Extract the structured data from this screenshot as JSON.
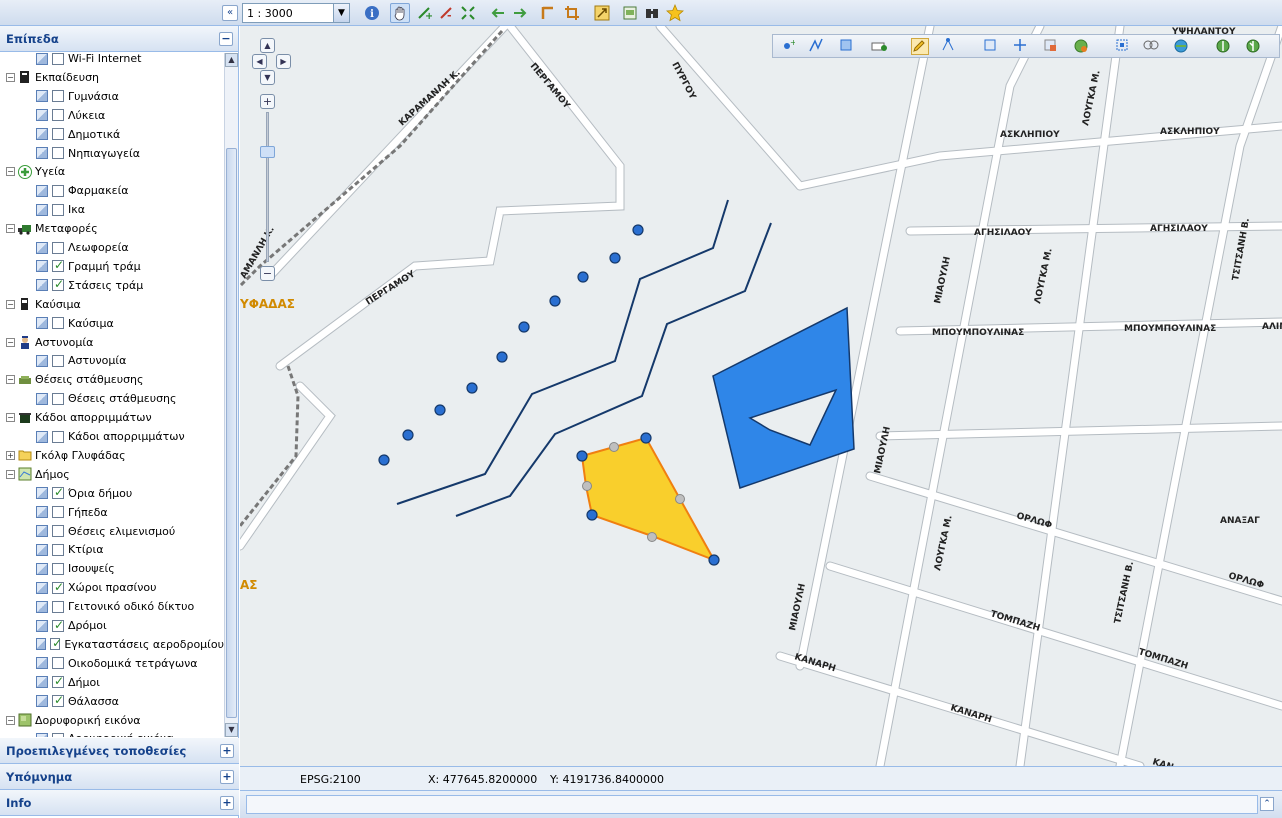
{
  "toolbar": {
    "scale_value": "1 : 3000",
    "collapse_icon": "double-chevron-left-icon",
    "tools": [
      "info-icon",
      "pan-hand-icon",
      "zoom-in-icon",
      "zoom-out-icon",
      "zoom-extent-icon",
      "previous-extent-icon",
      "next-extent-icon",
      "measure-distance-icon",
      "measure-area-icon",
      "export-icon",
      "print-icon",
      "bookmark-icon",
      "favorite-star-icon"
    ]
  },
  "left_panel": {
    "layers_title": "Επίπεδα",
    "sections": [
      {
        "title": "Προεπιλεγμένες τοποθεσίες"
      },
      {
        "title": "Υπόμνημα"
      },
      {
        "title": "Info"
      }
    ],
    "tree": [
      {
        "kind": "layer",
        "label": "Wi-Fi Internet",
        "checked": false
      },
      {
        "kind": "group",
        "label": "Εκπαίδευση",
        "icon": "education-icon"
      },
      {
        "kind": "layer",
        "label": "Γυμνάσια",
        "checked": false
      },
      {
        "kind": "layer",
        "label": "Λύκεια",
        "checked": false
      },
      {
        "kind": "layer",
        "label": "Δημοτικά",
        "checked": false
      },
      {
        "kind": "layer",
        "label": "Νηπιαγωγεία",
        "checked": false
      },
      {
        "kind": "group",
        "label": "Υγεία",
        "icon": "health-cross-icon"
      },
      {
        "kind": "layer",
        "label": "Φαρμακεία",
        "checked": false
      },
      {
        "kind": "layer",
        "label": "Ικα",
        "checked": false
      },
      {
        "kind": "group",
        "label": "Μεταφορές",
        "icon": "transport-truck-icon"
      },
      {
        "kind": "layer",
        "label": "Λεωφορεία",
        "checked": false
      },
      {
        "kind": "layer",
        "label": "Γραμμή τράμ",
        "checked": true
      },
      {
        "kind": "layer",
        "label": "Στάσεις τράμ",
        "checked": true
      },
      {
        "kind": "group",
        "label": "Καύσιμα",
        "icon": "fuel-pump-icon"
      },
      {
        "kind": "layer",
        "label": "Καύσιμα",
        "checked": false
      },
      {
        "kind": "group",
        "label": "Αστυνομία",
        "icon": "police-officer-icon"
      },
      {
        "kind": "layer",
        "label": "Αστυνομία",
        "checked": false
      },
      {
        "kind": "group",
        "label": "Θέσεις στάθμευσης",
        "icon": "parking-car-icon"
      },
      {
        "kind": "layer",
        "label": "Θέσεις στάθμευσης",
        "checked": false
      },
      {
        "kind": "group",
        "label": "Κάδοι απορριμμάτων",
        "icon": "trash-bin-icon"
      },
      {
        "kind": "layer",
        "label": "Κάδοι απορριμμάτων",
        "checked": false
      },
      {
        "kind": "group",
        "label": "Γκόλφ Γλυφάδας",
        "icon": "folder-icon",
        "collapsed": true
      },
      {
        "kind": "group",
        "label": "Δήμος",
        "icon": "municipality-map-icon"
      },
      {
        "kind": "layer",
        "label": "Όρια δήμου",
        "checked": true
      },
      {
        "kind": "layer",
        "label": "Γήπεδα",
        "checked": false
      },
      {
        "kind": "layer",
        "label": "Θέσεις ελιμενισμού",
        "checked": false
      },
      {
        "kind": "layer",
        "label": "Κτίρια",
        "checked": false
      },
      {
        "kind": "layer",
        "label": "Ισουψείς",
        "checked": false
      },
      {
        "kind": "layer",
        "label": "Χώροι πρασίνου",
        "checked": true
      },
      {
        "kind": "layer",
        "label": "Γειτονικό οδικό δίκτυο",
        "checked": false
      },
      {
        "kind": "layer",
        "label": "Δρόμοι",
        "checked": true
      },
      {
        "kind": "layer",
        "label": "Εγκαταστάσεις αεροδρομίου",
        "checked": true
      },
      {
        "kind": "layer",
        "label": "Οικοδομικά τετράγωνα",
        "checked": false
      },
      {
        "kind": "layer",
        "label": "Δήμοι",
        "checked": true
      },
      {
        "kind": "layer",
        "label": "Θάλασσα",
        "checked": true
      },
      {
        "kind": "group",
        "label": "Δορυφορική εικόνα",
        "icon": "satellite-image-icon"
      },
      {
        "kind": "layer",
        "label": "Δορυφορική εικόνα",
        "checked": false
      }
    ]
  },
  "map": {
    "streets": {
      "ypsilantou": "ΥΨΗΛΑΝΤΟΥ",
      "pyrgou": "ΠΥΡΓΟΥ",
      "pergamou": "ΠΕΡΓΑΜΟΥ",
      "karamanli": "ΚΑΡΑΜΑΝΛΗ Κ.",
      "amanli": "ΑΜΑΝΛΗ Κ.",
      "loygka": "ΛΟΥΓΚΑ Μ.",
      "asklipiou": "ΑΣΚΛΗΠΙΟΥ",
      "agisilaou": "ΑΓΗΣΙΛΑΟΥ",
      "tsitsani": "ΤΣΙΤΣΑΝΗ Β.",
      "miaouli": "ΜΙΑΟΥΛΗ",
      "mpoumpoulinas": "ΜΠΟΥΜΠΟΥΛΙΝΑΣ",
      "alim": "ΑΛΙΜ",
      "orlof": "ΟΡΛΩΦ",
      "anaxag": "ΑΝΑΞΑΓ",
      "tompazi": "ΤΟΜΠΑΖΗ",
      "kanari": "ΚΑΝΑΡΗ",
      "kan": "ΚΑΝ"
    },
    "town_labels": {
      "glyfada_partial": "ΥΦΑΔΑΣ",
      "glyfada_partial2": "ΑΣ"
    },
    "colors": {
      "background": "#eaeef0",
      "road": "#ffffff",
      "road_casing": "#b5bcc2",
      "drawn_line": "#15396b",
      "point": "#2a6fd1",
      "polygon_selected": "#f9cf2c",
      "polygon_selected_stroke": "#f07f10",
      "polygon_blue": "#2f86e8"
    },
    "edit_tools": [
      "draw-point-icon",
      "draw-line-icon",
      "draw-polygon-icon",
      "add-feature-icon",
      "edit-pencil-icon",
      "modify-vertices-icon",
      "select-feature-icon",
      "move-feature-icon",
      "delete-feature-icon",
      "snapping-icon",
      "split-icon",
      "merge-icon",
      "attributes-icon",
      "save-icon",
      "cancel-icon"
    ]
  },
  "status": {
    "epsg": "EPSG:2100",
    "x": "X: 477645.8200000",
    "y": "Y: 4191736.8400000"
  }
}
